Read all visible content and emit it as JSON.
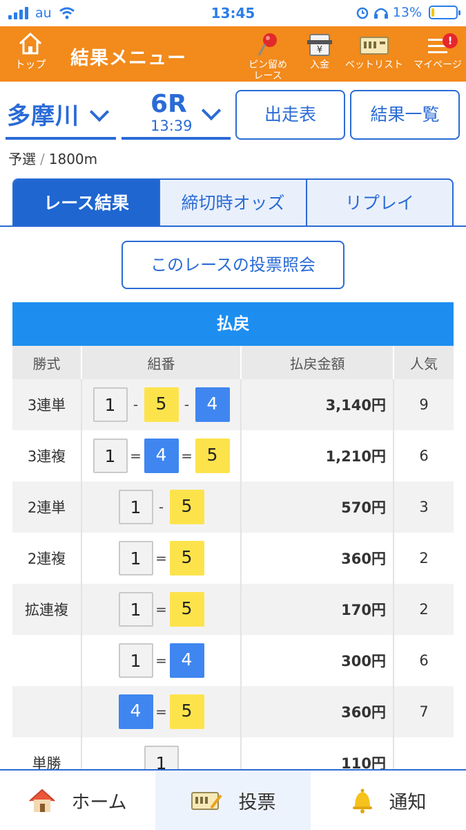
{
  "status_bar": {
    "carrier": "au",
    "time": "13:45",
    "battery": "13%",
    "battery_level": 0.13
  },
  "header": {
    "home_label": "トップ",
    "title": "結果メニュー",
    "pin_label_1": "ピン留め",
    "pin_label_2": "レース",
    "deposit_label": "入金",
    "betlist_label": "ベットリスト",
    "mypage_label": "マイページ",
    "mypage_badge": "!"
  },
  "race": {
    "venue": "多摩川",
    "number": "6R",
    "time": "13:39",
    "entries_button": "出走表",
    "results_button": "結果一覧",
    "grade": "予選",
    "separator": "/",
    "distance": "1800m"
  },
  "tabs": [
    "レース結果",
    "締切時オッズ",
    "リプレイ"
  ],
  "vote_inquiry_button": "このレースの投票照会",
  "payout": {
    "title": "払戻",
    "columns": [
      "勝式",
      "組番",
      "払戻金額",
      "人気"
    ],
    "rows": [
      {
        "kind": "3連単",
        "combo": [
          "1",
          "-",
          "5",
          "-",
          "4"
        ],
        "amount": "3,140円",
        "popularity": "9"
      },
      {
        "kind": "3連複",
        "combo": [
          "1",
          "=",
          "4",
          "=",
          "5"
        ],
        "amount": "1,210円",
        "popularity": "6"
      },
      {
        "kind": "2連単",
        "combo": [
          "1",
          "-",
          "5"
        ],
        "amount": "570円",
        "popularity": "3"
      },
      {
        "kind": "2連複",
        "combo": [
          "1",
          "=",
          "5"
        ],
        "amount": "360円",
        "popularity": "2"
      },
      {
        "kind": "拡連複",
        "combo": [
          "1",
          "=",
          "5"
        ],
        "amount": "170円",
        "popularity": "2"
      },
      {
        "kind": "",
        "combo": [
          "1",
          "=",
          "4"
        ],
        "amount": "300円",
        "popularity": "6"
      },
      {
        "kind": "",
        "combo": [
          "4",
          "=",
          "5"
        ],
        "amount": "360円",
        "popularity": "7"
      },
      {
        "kind": "単勝",
        "combo": [
          "1"
        ],
        "amount": "110円",
        "popularity": ""
      }
    ]
  },
  "bottom_nav": {
    "home": "ホーム",
    "vote": "投票",
    "notify": "通知"
  },
  "colors": {
    "header": "#f28a1c",
    "accent": "#2a6bd6",
    "payout_header": "#1d8ef0",
    "boat_4": "#3f86f0",
    "boat_5": "#fde34b"
  }
}
